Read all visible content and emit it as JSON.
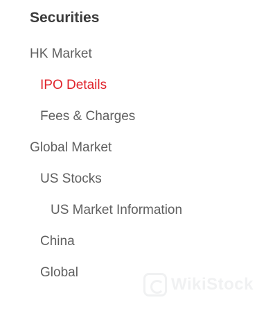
{
  "sidebar": {
    "title": "Securities",
    "items": [
      {
        "label": "HK Market"
      },
      {
        "label": "IPO Details",
        "active": true
      },
      {
        "label": "Fees & Charges"
      },
      {
        "label": "Global Market"
      },
      {
        "label": "US Stocks"
      },
      {
        "label": "US Market Information"
      },
      {
        "label": "China"
      },
      {
        "label": "Global"
      }
    ]
  },
  "watermark": {
    "text": "WikiStock"
  },
  "colors": {
    "active": "#e0232b",
    "text": "#5f5f5f",
    "title": "#3b3b3b"
  }
}
